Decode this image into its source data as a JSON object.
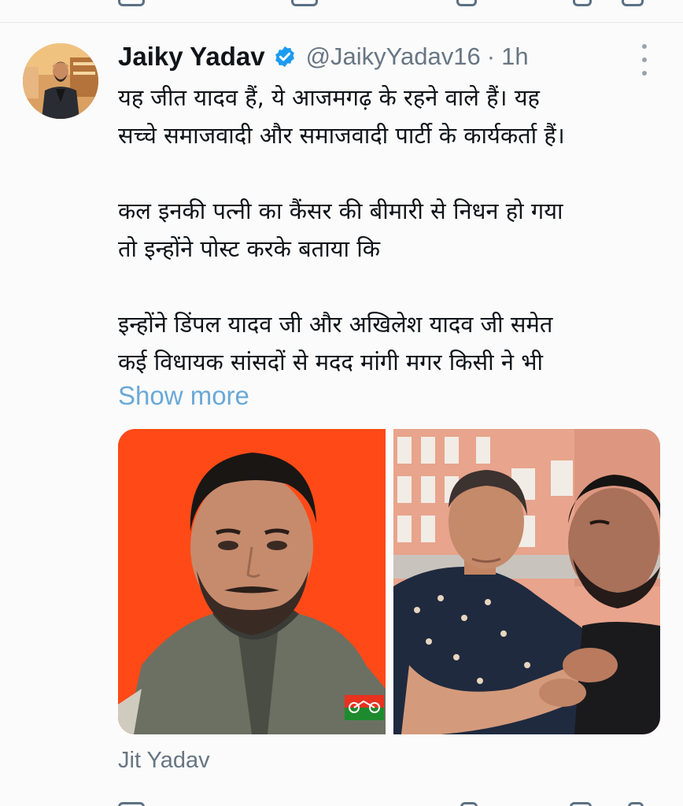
{
  "tweet": {
    "author": {
      "display_name": "Jaiky Yadav",
      "handle": "@JaikyYadav16",
      "verified": true,
      "verified_color": "#1d9bf0"
    },
    "separator": "·",
    "timestamp": "1h",
    "text_paragraphs": [
      [
        "यह जीत यादव हैं, ये आजमगढ़ के रहने वाले हैं। यह",
        "सच्चे समाजवादी और समाजवादी पार्टी के कार्यकर्ता हैं।"
      ],
      [
        "कल इनकी पत्नी का कैंसर की बीमारी से निधन हो गया",
        "तो इन्होंने पोस्ट करके बताया कि"
      ],
      [
        "इन्होंने डिंपल यादव जी और अखिलेश यादव जी समेत",
        "कई विधायक सांसदों से मदद मांगी मगर किसी ने भी"
      ]
    ],
    "show_more_label": "Show more",
    "show_more_color": "#6aa9d8",
    "media": [
      {
        "description_icon": "photo-man-orange-background"
      },
      {
        "description_icon": "photo-couple-outside-building"
      }
    ],
    "media_caption": "Jit Yadav",
    "menu_icon": "more-vertical-icon"
  },
  "colors": {
    "background": "#fbfbfb",
    "text_primary": "#0f1419",
    "text_secondary": "#687684",
    "divider": "#e6e6e6"
  }
}
